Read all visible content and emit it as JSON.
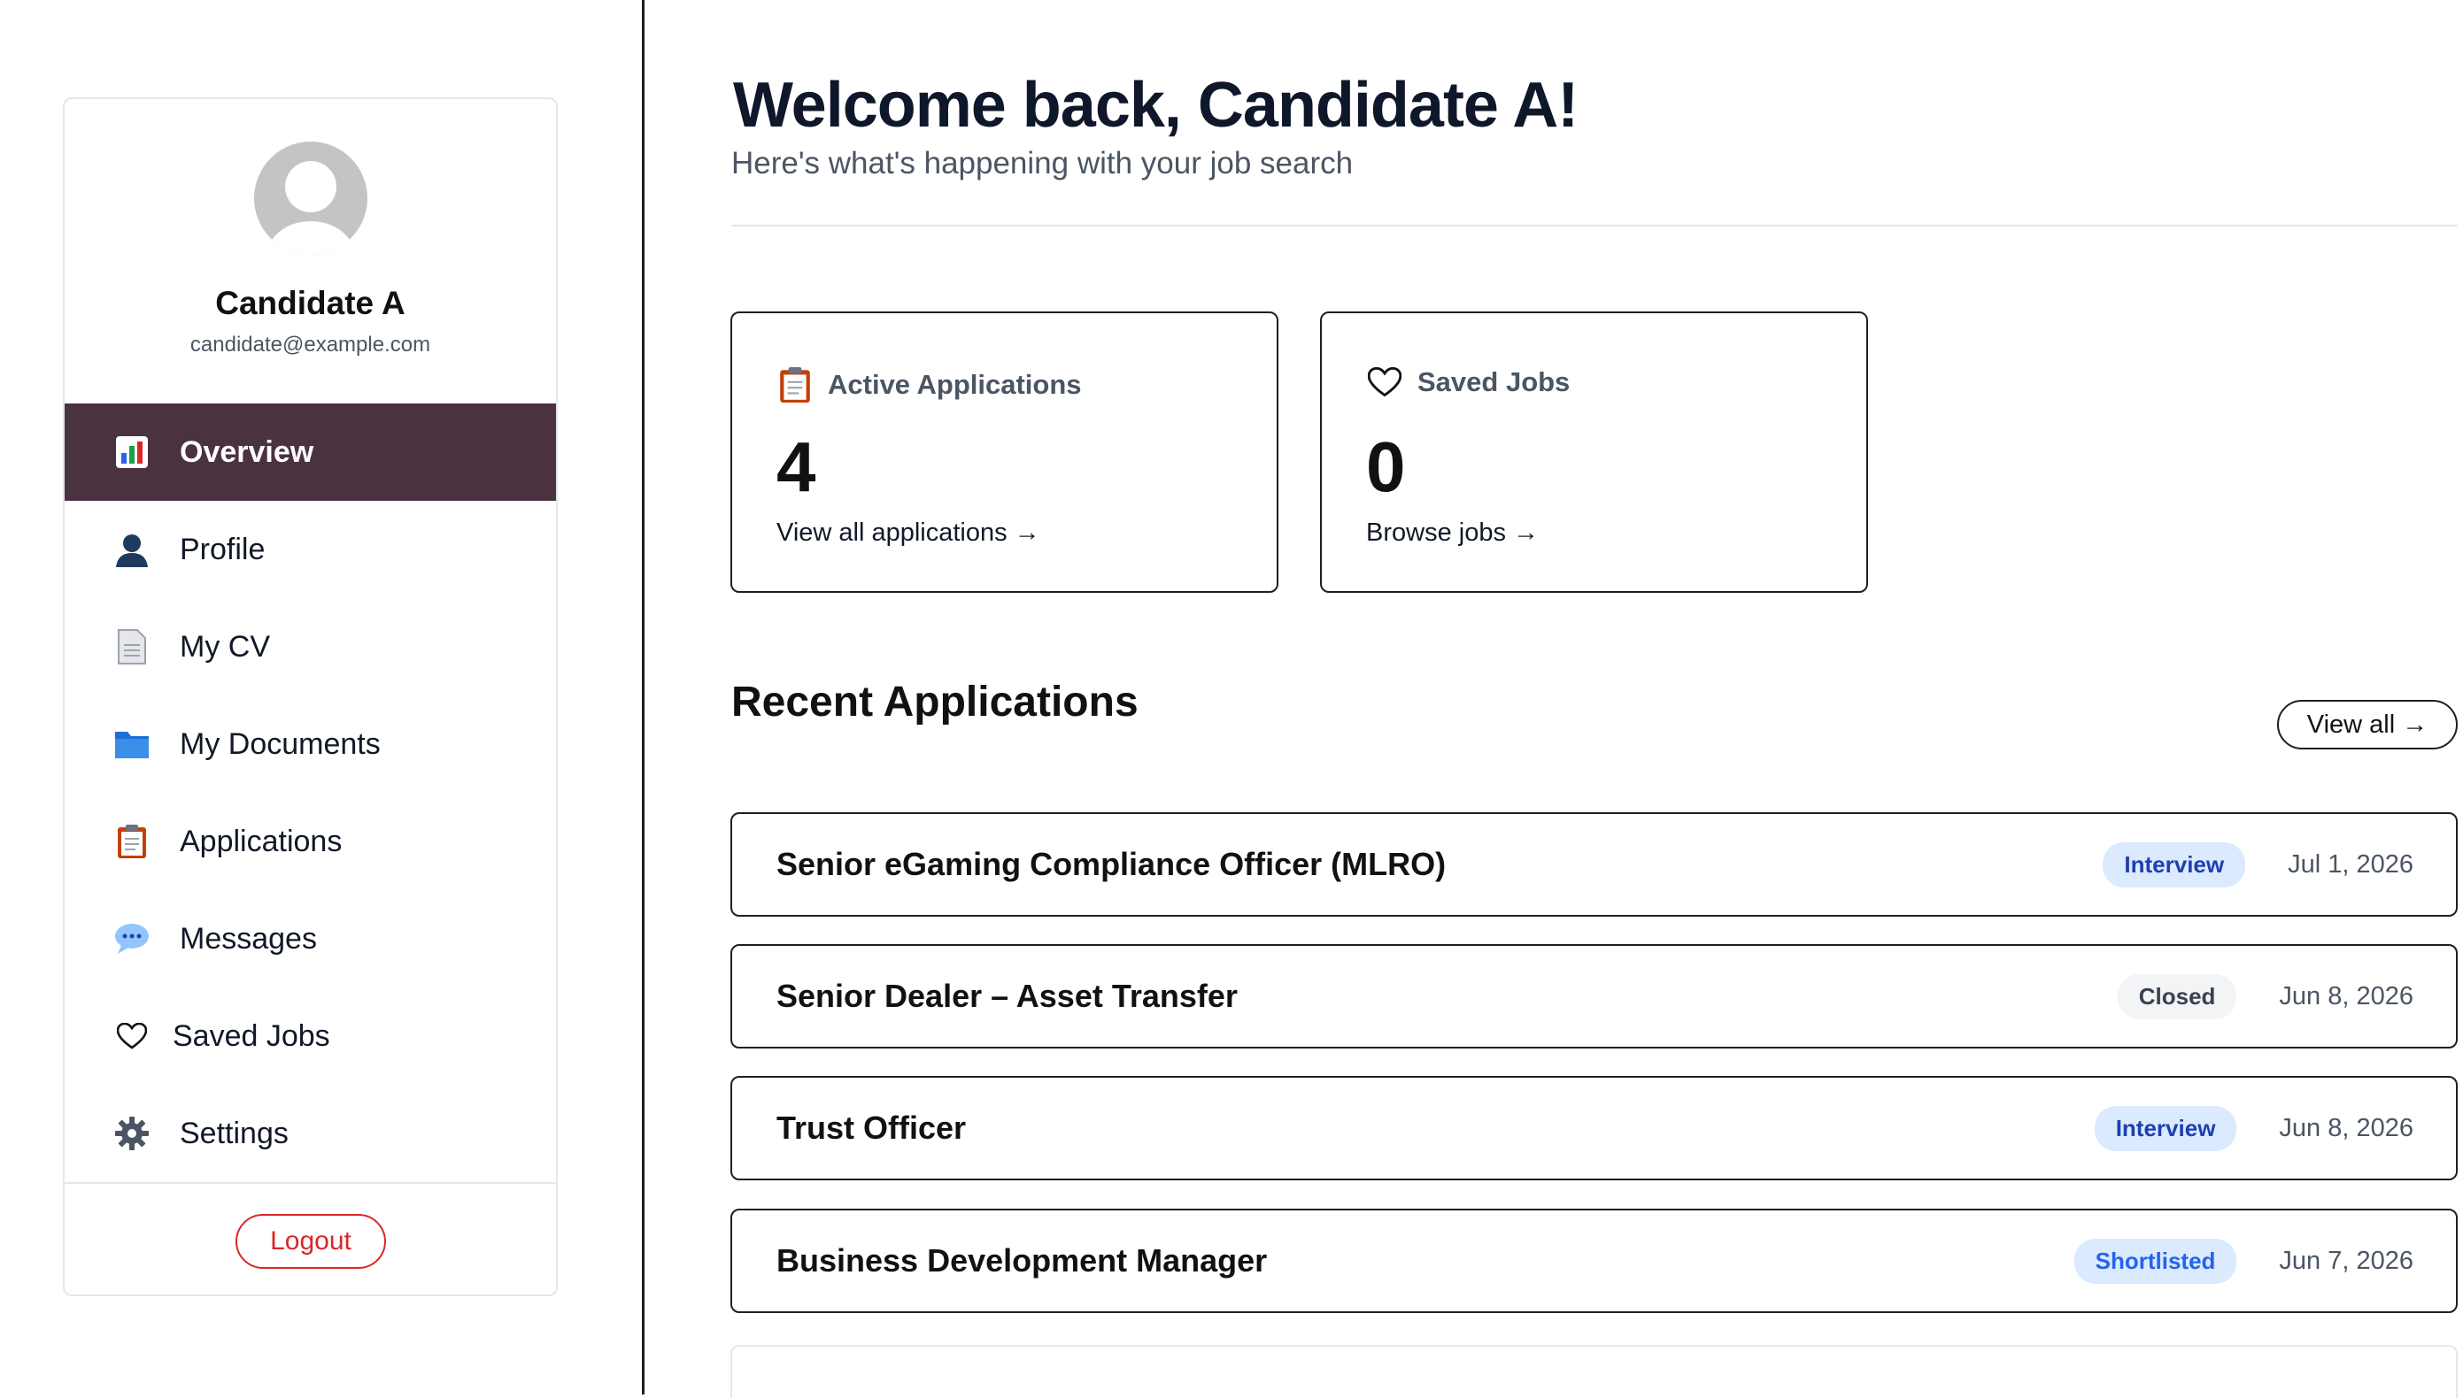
{
  "sidebar": {
    "user": {
      "name": "Candidate A",
      "email": "candidate@example.com"
    },
    "items": [
      {
        "label": "Overview",
        "icon": "bar-chart-icon",
        "active": true
      },
      {
        "label": "Profile",
        "icon": "person-icon"
      },
      {
        "label": "My CV",
        "icon": "document-icon"
      },
      {
        "label": "My Documents",
        "icon": "folder-icon"
      },
      {
        "label": "Applications",
        "icon": "clipboard-icon"
      },
      {
        "label": "Messages",
        "icon": "chat-bubble-icon"
      },
      {
        "label": "Saved Jobs",
        "icon": "heart-icon"
      },
      {
        "label": "Settings",
        "icon": "gear-icon"
      }
    ],
    "logout_label": "Logout"
  },
  "header": {
    "title": "Welcome back, Candidate A!",
    "subtitle": "Here's what's happening with your job search"
  },
  "stats": [
    {
      "label": "Active Applications",
      "value": "4",
      "link": "View all applications →",
      "icon": "clipboard-icon"
    },
    {
      "label": "Saved Jobs",
      "value": "0",
      "link": "Browse jobs →",
      "icon": "heart-icon"
    }
  ],
  "recent": {
    "title": "Recent Applications",
    "view_all_label": "View all →",
    "applications": [
      {
        "title": "Senior eGaming Compliance Officer (MLRO)",
        "status": "Interview",
        "date": "Jul 1, 2026"
      },
      {
        "title": "Senior Dealer – Asset Transfer",
        "status": "Closed",
        "date": "Jun 8, 2026"
      },
      {
        "title": "Trust Officer",
        "status": "Interview",
        "date": "Jun 8, 2026"
      },
      {
        "title": "Business Development Manager",
        "status": "Shortlisted",
        "date": "Jun 7, 2026"
      }
    ]
  },
  "colors": {
    "sidebar_active_bg": "#4a3241",
    "logout_red": "#dc2626",
    "badge_blue_bg": "#dbeafe",
    "badge_blue_text": "#1e40af"
  }
}
